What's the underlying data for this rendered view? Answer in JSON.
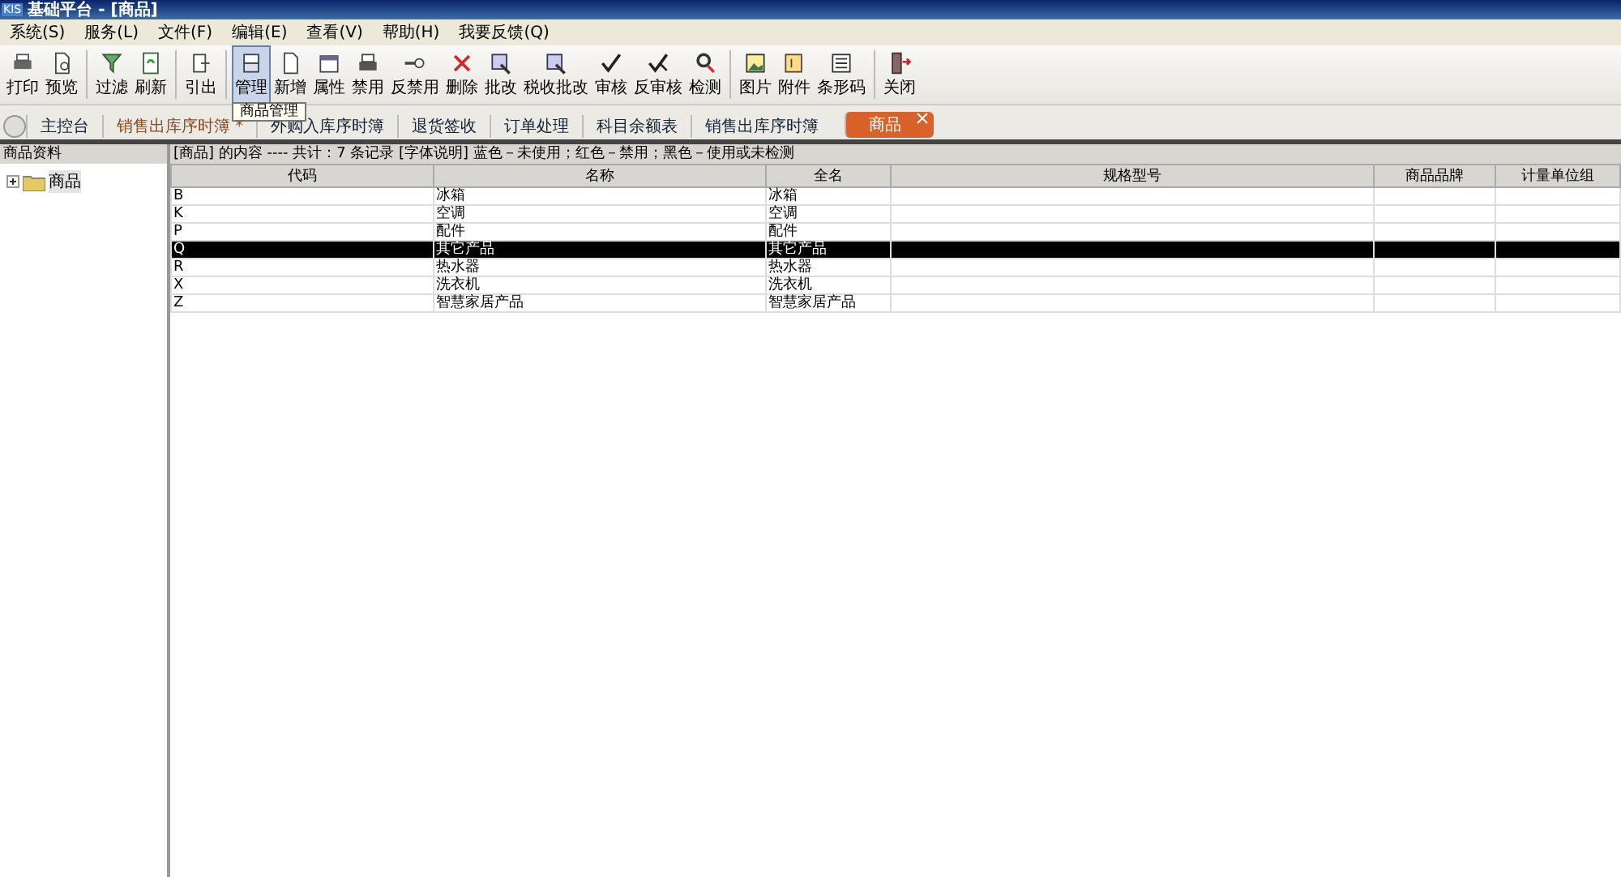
{
  "window": {
    "app_badge": "KIS",
    "title": "基础平台 - [商品]"
  },
  "menu": [
    "系统(S)",
    "服务(L)",
    "文件(F)",
    "编辑(E)",
    "查看(V)",
    "帮助(H)",
    "我要反馈(Q)"
  ],
  "toolbar": {
    "groups": [
      [
        {
          "label": "打印",
          "selected": false
        },
        {
          "label": "预览",
          "selected": false
        }
      ],
      [
        {
          "label": "过滤",
          "selected": false
        },
        {
          "label": "刷新",
          "selected": false
        }
      ],
      [
        {
          "label": "引出",
          "selected": false
        }
      ],
      [
        {
          "label": "管理",
          "selected": true
        },
        {
          "label": "新增",
          "selected": false
        },
        {
          "label": "属性",
          "selected": false
        },
        {
          "label": "禁用",
          "selected": false
        },
        {
          "label": "反禁用",
          "selected": false
        },
        {
          "label": "删除",
          "selected": false
        },
        {
          "label": "批改",
          "selected": false
        },
        {
          "label": "税收批改",
          "selected": false
        },
        {
          "label": "审核",
          "selected": false
        },
        {
          "label": "反审核",
          "selected": false
        },
        {
          "label": "检测",
          "selected": false
        }
      ],
      [
        {
          "label": "图片",
          "selected": false
        },
        {
          "label": "附件",
          "selected": false
        },
        {
          "label": "条形码",
          "selected": false
        }
      ],
      [
        {
          "label": "关闭",
          "selected": false
        }
      ]
    ],
    "tooltip": "商品管理"
  },
  "tabs": [
    {
      "label": "主控台",
      "selected": false,
      "kind": "link"
    },
    {
      "label": "销售出库序时簿 *",
      "selected": false,
      "kind": "modified"
    },
    {
      "label": "外购入库序时簿",
      "selected": false,
      "kind": "link"
    },
    {
      "label": "退货签收",
      "selected": false,
      "kind": "link"
    },
    {
      "label": "订单处理",
      "selected": false,
      "kind": "link"
    },
    {
      "label": "科目余额表",
      "selected": false,
      "kind": "link"
    },
    {
      "label": "销售出库序时簿",
      "selected": false,
      "kind": "link"
    },
    {
      "label": "商品",
      "selected": true,
      "kind": "link"
    }
  ],
  "sidebar": {
    "title": "商品资料",
    "tree": [
      {
        "label": "商品",
        "expanded": false
      }
    ]
  },
  "table": {
    "summary": "[商品] 的内容 ---- 共计：7 条记录  [字体说明] 蓝色－未使用；红色－禁用；黑色－使用或未检测",
    "columns": [
      "代码",
      "名称",
      "全名",
      "规格型号",
      "商品品牌",
      "计量单位组"
    ],
    "rows": [
      {
        "cells": [
          "B",
          "冰箱",
          "冰箱"
        ],
        "selected": false
      },
      {
        "cells": [
          "K",
          "空调",
          "空调"
        ],
        "selected": false
      },
      {
        "cells": [
          "P",
          "配件",
          "配件"
        ],
        "selected": false
      },
      {
        "cells": [
          "Q",
          "其它产品",
          "其它产品"
        ],
        "selected": true
      },
      {
        "cells": [
          "R",
          "热水器",
          "热水器"
        ],
        "selected": false
      },
      {
        "cells": [
          "X",
          "洗衣机",
          "洗衣机"
        ],
        "selected": false
      },
      {
        "cells": [
          "Z",
          "智慧家居产品",
          "智慧家居产品"
        ],
        "selected": false
      }
    ]
  }
}
